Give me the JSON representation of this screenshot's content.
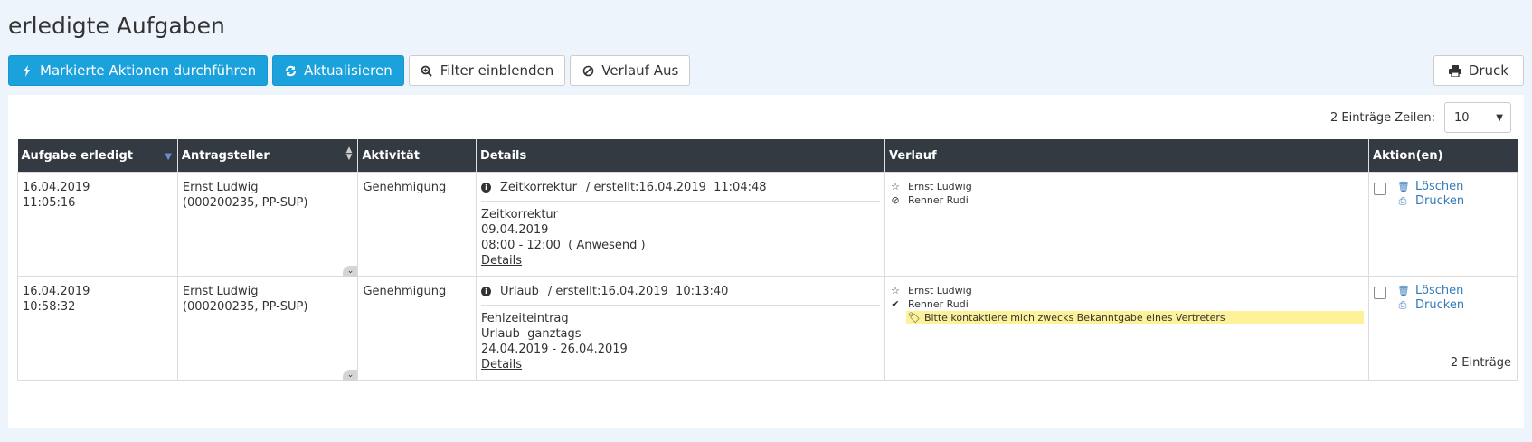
{
  "page": {
    "title": "erledigte Aufgaben"
  },
  "toolbar": {
    "execute": "Markierte Aktionen durchführen",
    "refresh": "Aktualisieren",
    "filter": "Filter einblenden",
    "history": "Verlauf Aus",
    "print": "Druck"
  },
  "meta": {
    "count": "2 Einträge",
    "rows_label": "Zeilen:",
    "rows_value": "10"
  },
  "columns": {
    "done": "Aufgabe erledigt",
    "requester": "Antragsteller",
    "activity": "Aktivität",
    "details": "Details",
    "history": "Verlauf",
    "actions": "Aktion(en)"
  },
  "rows": [
    {
      "date": "16.04.2019",
      "time": "11:05:16",
      "requester": "Ernst Ludwig",
      "requester_id": "(000200235, PP-SUP)",
      "activity": "Genehmigung",
      "detail_type": "Zeitkorrektur",
      "created": "/ erstellt:16.04.2019",
      "created_time": "11:04:48",
      "line1": "Zeitkorrektur",
      "line2": "09.04.2019",
      "line3": "08:00 - 12:00  ( Anwesend )",
      "detail_link": "Details",
      "history1": "Ernst Ludwig",
      "history2": "Renner Rudi",
      "delete": "Löschen",
      "print": "Drucken"
    },
    {
      "date": "16.04.2019",
      "time": "10:58:32",
      "requester": "Ernst Ludwig",
      "requester_id": "(000200235, PP-SUP)",
      "activity": "Genehmigung",
      "detail_type": "Urlaub",
      "created": "/ erstellt:16.04.2019",
      "created_time": "10:13:40",
      "line1": "Fehlzeiteintrag",
      "line2": "Urlaub  ganztags",
      "line3": "24.04.2019 - 26.04.2019",
      "detail_link": "Details",
      "history1": "Ernst Ludwig",
      "history2": "Renner Rudi",
      "note": "Bitte kontaktiere mich zwecks Bekanntgabe eines Vertreters",
      "delete": "Löschen",
      "print": "Drucken"
    }
  ],
  "footer": {
    "count": "2 Einträge"
  }
}
